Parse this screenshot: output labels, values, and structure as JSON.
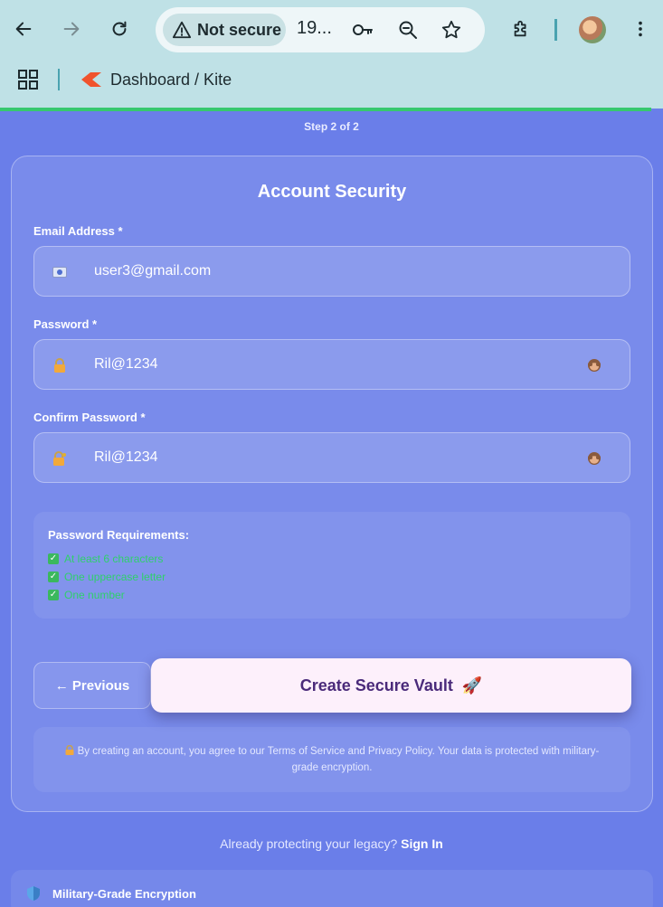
{
  "browser": {
    "security_chip": "Not secure",
    "url": "19...",
    "bookmark": "Dashboard / Kite"
  },
  "page": {
    "step": "Step 2 of 2",
    "title": "Account Security",
    "email_label": "Email Address *",
    "email_value": "user3@gmail.com",
    "password_label": "Password *",
    "password_value": "Ril@1234",
    "confirm_label": "Confirm Password *",
    "confirm_value": "Ril@1234",
    "requirements": {
      "title": "Password Requirements:",
      "items": [
        "At least 6 characters",
        "One uppercase letter",
        "One number"
      ]
    },
    "previous_label": "← Previous",
    "create_label": "Create Secure Vault",
    "create_emoji": "🚀",
    "terms_text": "By creating an account, you agree to our Terms of Service and Privacy Policy. Your data is protected with military-grade encryption.",
    "signin_prompt": "Already protecting your legacy?",
    "signin_link": "Sign In",
    "feature_label": "Military-Grade Encryption"
  },
  "icons": {
    "email": "email-icon",
    "lock": "lock-icon",
    "lock_key": "lock-key-icon",
    "eye": "monkey-eye-icon",
    "shield": "shield-icon"
  },
  "colors": {
    "background": "#6a7ee9",
    "check": "#2fd06b",
    "button": "#fdf0fb",
    "button_text": "#4a2a7a",
    "chrome": "#bfe1e6"
  }
}
